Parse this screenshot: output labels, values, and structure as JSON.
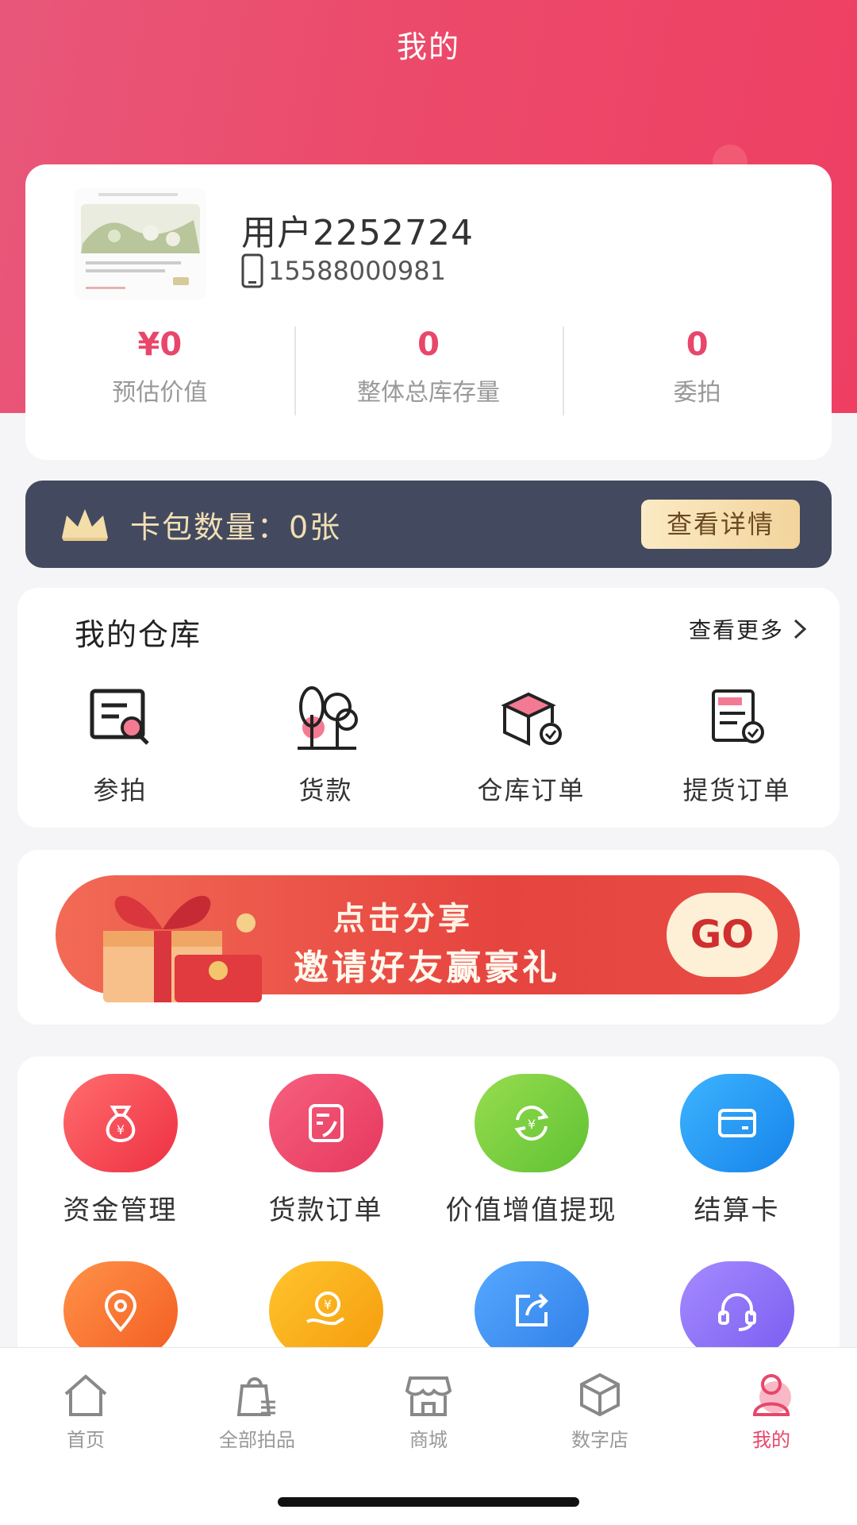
{
  "header": {
    "title": "我的"
  },
  "profile": {
    "username": "用户2252724",
    "phone": "15588000981",
    "stats": [
      {
        "value": "¥0",
        "label": "预估价值"
      },
      {
        "value": "0",
        "label": "整体总库存量"
      },
      {
        "value": "0",
        "label": "委拍"
      }
    ]
  },
  "card_pack": {
    "text": "卡包数量：0张",
    "button": "查看详情"
  },
  "warehouse": {
    "title": "我的仓库",
    "more": "查看更多",
    "items": [
      {
        "label": "参拍",
        "icon": "auction-doc-icon"
      },
      {
        "label": "货款",
        "icon": "trees-icon"
      },
      {
        "label": "仓库订单",
        "icon": "box-check-icon"
      },
      {
        "label": "提货订单",
        "icon": "doc-check-icon"
      }
    ]
  },
  "banner": {
    "line1": "点击分享",
    "line2": "邀请好友赢豪礼",
    "go": "GO"
  },
  "services": [
    {
      "label": "资金管理",
      "icon": "money-bag-icon",
      "color": "#f24c56"
    },
    {
      "label": "货款订单",
      "icon": "note-icon",
      "color": "#ef4a6c"
    },
    {
      "label": "价值增值提现",
      "icon": "exchange-icon",
      "color": "#7ccf3c"
    },
    {
      "label": "结算卡",
      "icon": "card-icon",
      "color": "#2b98f3"
    },
    {
      "label": "",
      "icon": "location-icon",
      "color": "#f67a2c"
    },
    {
      "label": "",
      "icon": "coin-hand-icon",
      "color": "#fbb012"
    },
    {
      "label": "",
      "icon": "share-icon",
      "color": "#3a8ff0"
    },
    {
      "label": "",
      "icon": "headset-icon",
      "color": "#8c6ff0"
    }
  ],
  "tabbar": [
    {
      "label": "首页",
      "icon": "home-icon"
    },
    {
      "label": "全部拍品",
      "icon": "bag-icon"
    },
    {
      "label": "商城",
      "icon": "store-icon"
    },
    {
      "label": "数字店",
      "icon": "cube-icon"
    },
    {
      "label": "我的",
      "icon": "user-icon",
      "active": true
    }
  ],
  "colors": {
    "accent": "#e8466a",
    "header": "#ec4a6a",
    "vip_bar": "#434a5f"
  }
}
